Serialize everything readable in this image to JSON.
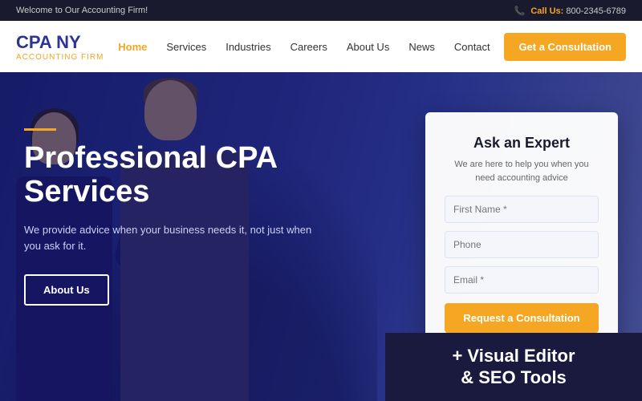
{
  "topbar": {
    "welcome": "Welcome to Our Accounting Firm!",
    "call_label": "Call Us:",
    "phone": "800-2345-6789"
  },
  "header": {
    "logo_main": "CPA NY",
    "logo_sub": "Accounting Firm",
    "nav": [
      {
        "label": "Home",
        "active": true
      },
      {
        "label": "Services"
      },
      {
        "label": "Industries"
      },
      {
        "label": "Careers"
      },
      {
        "label": "About Us"
      },
      {
        "label": "News"
      },
      {
        "label": "Contact"
      }
    ],
    "cta": "Get a Consultation"
  },
  "hero": {
    "accent": "",
    "heading_line1": "Professional CPA",
    "heading_line2": "Services",
    "subtext": "We provide advice when your business needs it, not just when you ask for it.",
    "about_btn": "About Us"
  },
  "form": {
    "title": "Ask an Expert",
    "description": "We are here to help you when you need accounting advice",
    "field_first_name": "First Name *",
    "field_phone": "Phone",
    "field_email": "Email *",
    "submit_btn": "Request a Consultation"
  },
  "promo": {
    "line1": "+ Visual Editor",
    "line2": "& SEO Tools"
  }
}
